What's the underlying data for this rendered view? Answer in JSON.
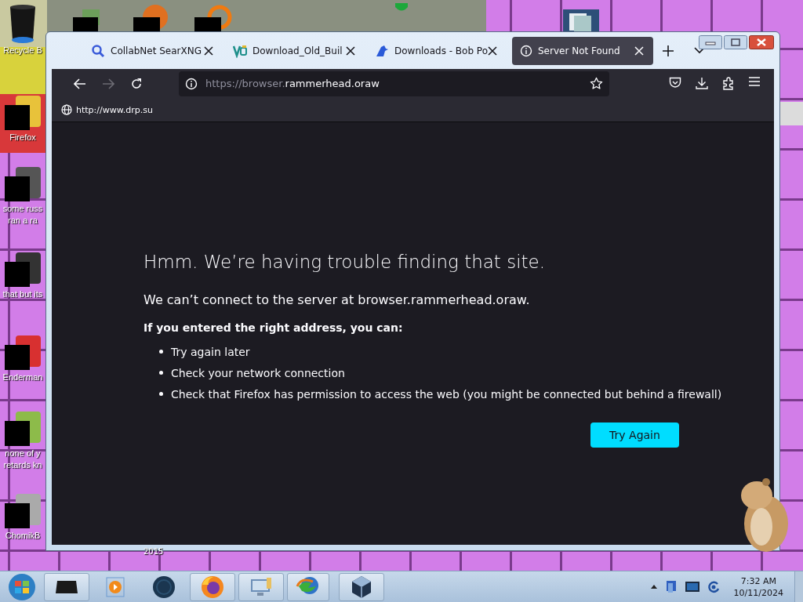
{
  "desktop_icons": [
    {
      "kind": "bin",
      "lines": [
        "Recycle B"
      ]
    },
    {
      "kind": "app",
      "lines": [
        "Firefox"
      ]
    },
    {
      "kind": "app",
      "lines": [
        "some russ",
        "ran a ra"
      ]
    },
    {
      "kind": "app",
      "lines": [
        "that but its"
      ]
    },
    {
      "kind": "app",
      "lines": [
        "Enderman"
      ]
    },
    {
      "kind": "app",
      "lines": [
        "none of y",
        "retards kn"
      ]
    },
    {
      "kind": "app",
      "lines": [
        "ChomikB"
      ]
    }
  ],
  "desktop_label": "2015",
  "window": {
    "tabs": [
      {
        "title": "CollabNet SearXNG",
        "selected": false
      },
      {
        "title": "Download_Old_Buil",
        "selected": false
      },
      {
        "title": "Downloads - Bob Po",
        "selected": false
      },
      {
        "title": "Server Not Found",
        "selected": true
      }
    ],
    "url_prefix": "https://browser.",
    "url_domain": "rammerhead.oraw",
    "bookmarks": [
      {
        "label": "http://www.drp.su"
      }
    ],
    "error": {
      "title": "Hmm. We’re having trouble finding that site.",
      "message": "We can’t connect to the server at browser.rammerhead.oraw.",
      "intro": "If you entered the right address, you can:",
      "suggestions": [
        "Try again later",
        "Check your network connection",
        "Check that Firefox has permission to access the web (you might be connected but behind a firewall)"
      ],
      "button": "Try Again"
    }
  },
  "taskbar": {
    "time": "7:32 AM",
    "date": "10/11/2024"
  }
}
